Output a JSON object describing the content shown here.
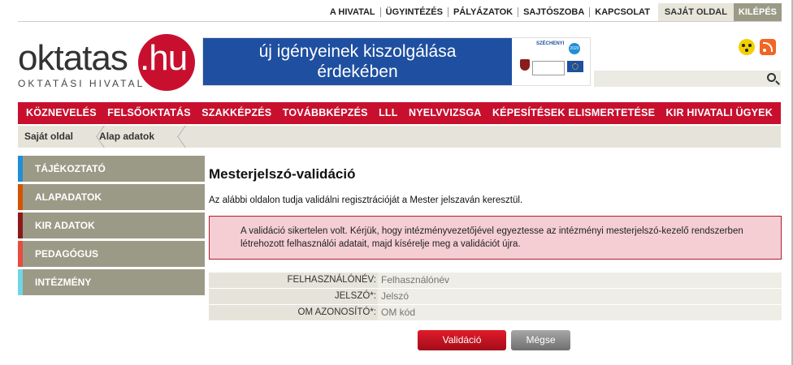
{
  "topbar": {
    "links": [
      "A HIVATAL",
      "ÜGYINTÉZÉS",
      "PÁLYÁZATOK",
      "SAJTÓSZOBA",
      "KAPCSOLAT"
    ],
    "own_page": "SAJÁT OLDAL",
    "logout": "KILÉPÉS"
  },
  "logo": {
    "word": "oktatas",
    "suffix": ".hu",
    "subtitle": "OKTATÁSI HIVATAL"
  },
  "banner": {
    "line1": "új igényeinek kiszolgálása",
    "line2": "érdekében",
    "program": "SZÉCHENYI",
    "program_year": "2020"
  },
  "search": {
    "placeholder": "",
    "icon": "search-icon"
  },
  "main_nav": [
    "KÖZNEVELÉS",
    "FELSŐOKTATÁS",
    "SZAKKÉPZÉS",
    "TOVÁBBKÉPZÉS",
    "LLL",
    "NYELVVIZSGA",
    "KÉPESÍTÉSEK ELISMERTETÉSE",
    "KIR HIVATALI ÜGYEK"
  ],
  "breadcrumb": [
    "Saját oldal",
    "Alap adatok"
  ],
  "sidebar": [
    {
      "label": "TÁJÉKOZTATÓ",
      "color": "#1f8fd6"
    },
    {
      "label": "ALAPADATOK",
      "color": "#d35400"
    },
    {
      "label": "KIR ADATOK",
      "color": "#8b1a1a"
    },
    {
      "label": "PEDAGÓGUS",
      "color": "#e84c3d"
    },
    {
      "label": "INTÉZMÉNY",
      "color": "#6fd6e8"
    }
  ],
  "content": {
    "title": "Mesterjelszó-validáció",
    "intro": "Az alábbi oldalon tudja validálni regisztrációját a Mester jelszaván keresztül.",
    "alert": "A validáció sikertelen volt. Kérjük, hogy intézményvezetőjével egyeztesse az intézményi mesterjelszó-kezelő rendszerben létrehozott felhasználói adatait, majd kísérelje meg a validációt újra.",
    "fields": [
      {
        "label": "FELHASZNÁLÓNÉV:",
        "placeholder": "Felhasználónév"
      },
      {
        "label": "JELSZÓ*:",
        "placeholder": "Jelszó"
      },
      {
        "label": "OM AZONOSÍTÓ*:",
        "placeholder": "OM kód"
      }
    ],
    "submit": "Validáció",
    "cancel": "Mégse"
  }
}
